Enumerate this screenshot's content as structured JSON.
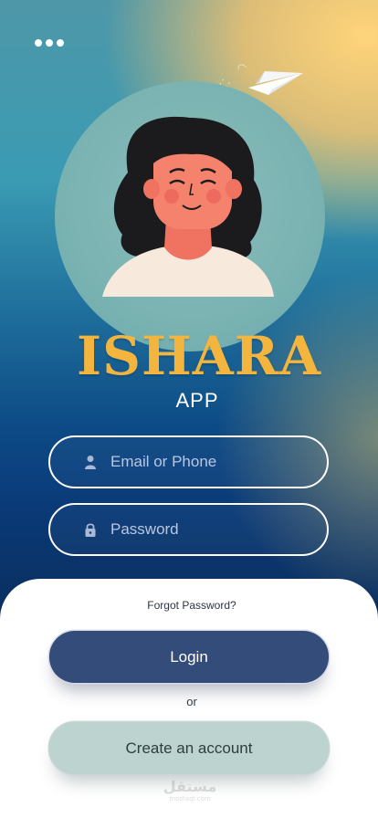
{
  "header": {
    "menu_icon": "more-horizontal-icon",
    "decoration_icon": "paper-plane-icon"
  },
  "hero": {
    "illustration": "woman-avatar-illustration"
  },
  "brand": {
    "title": "ISHARA",
    "subtitle": "APP",
    "title_color": "#f3b53e"
  },
  "login_form": {
    "email": {
      "placeholder": "Email or Phone",
      "value": "",
      "icon": "user-icon"
    },
    "password": {
      "placeholder": "Password",
      "value": "",
      "icon": "lock-icon"
    },
    "forgot_label": "Forgot Password?",
    "login_label": "Login",
    "or_label": "or",
    "create_label": "Create an account"
  },
  "colors": {
    "login_button": "#344c79",
    "create_button": "#bcd3cf"
  },
  "watermark": {
    "main": "مستقل",
    "sub": "mostaql.com"
  }
}
